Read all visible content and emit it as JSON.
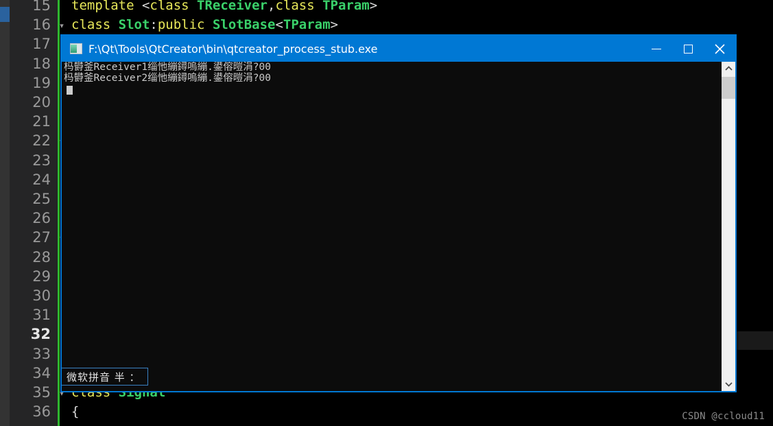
{
  "editor": {
    "lines": [
      {
        "num": "15",
        "fold": "",
        "current": false,
        "tokens": [
          {
            "t": "template ",
            "c": "kw"
          },
          {
            "t": "<",
            "c": "punc"
          },
          {
            "t": "class ",
            "c": "kw"
          },
          {
            "t": "TReceiver",
            "c": "type"
          },
          {
            "t": ",",
            "c": "punc"
          },
          {
            "t": "class ",
            "c": "kw"
          },
          {
            "t": "TParam",
            "c": "type"
          },
          {
            "t": ">",
            "c": "punc"
          }
        ]
      },
      {
        "num": "16",
        "fold": "▾",
        "current": false,
        "tokens": [
          {
            "t": "class ",
            "c": "kw"
          },
          {
            "t": "Slot",
            "c": "type"
          },
          {
            "t": ":",
            "c": "punc"
          },
          {
            "t": "public ",
            "c": "kw"
          },
          {
            "t": "SlotBase",
            "c": "type"
          },
          {
            "t": "<",
            "c": "punc"
          },
          {
            "t": "TParam",
            "c": "type"
          },
          {
            "t": ">",
            "c": "punc"
          }
        ]
      },
      {
        "num": "17",
        "fold": "",
        "current": false,
        "tokens": []
      },
      {
        "num": "18",
        "fold": "",
        "current": false,
        "tokens": []
      },
      {
        "num": "19",
        "fold": "",
        "current": false,
        "tokens": []
      },
      {
        "num": "20",
        "fold": "",
        "current": false,
        "tokens": []
      },
      {
        "num": "21",
        "fold": "",
        "current": false,
        "tokens": []
      },
      {
        "num": "22",
        "fold": "▾",
        "current": false,
        "tokens": []
      },
      {
        "num": "23",
        "fold": "",
        "current": false,
        "tokens": []
      },
      {
        "num": "24",
        "fold": "",
        "current": false,
        "tokens": []
      },
      {
        "num": "25",
        "fold": "",
        "current": false,
        "tokens": []
      },
      {
        "num": "26",
        "fold": "",
        "current": false,
        "tokens": []
      },
      {
        "num": "27",
        "fold": "▾",
        "current": false,
        "tokens": []
      },
      {
        "num": "28",
        "fold": "",
        "current": false,
        "tokens": []
      },
      {
        "num": "29",
        "fold": "",
        "current": false,
        "tokens": []
      },
      {
        "num": "30",
        "fold": "",
        "current": false,
        "tokens": []
      },
      {
        "num": "31",
        "fold": "",
        "current": false,
        "tokens": []
      },
      {
        "num": "32",
        "fold": "",
        "current": true,
        "tokens": []
      },
      {
        "num": "33",
        "fold": "",
        "current": false,
        "tokens": []
      },
      {
        "num": "34",
        "fold": "",
        "current": false,
        "tokens": []
      },
      {
        "num": "35",
        "fold": "▾",
        "current": false,
        "tokens": [
          {
            "t": "class ",
            "c": "kw"
          },
          {
            "t": "Signal",
            "c": "type"
          }
        ]
      },
      {
        "num": "36",
        "fold": "",
        "current": false,
        "tokens": [
          {
            "t": "{",
            "c": "punc"
          }
        ]
      }
    ],
    "change_bar_color": "#2fb72f",
    "marker_color": "#2a629e",
    "watermark": "CSDN @ccloud11"
  },
  "console": {
    "title": "F:\\Qt\\Tools\\QtCreator\\bin\\qtcreator_process_stub.exe",
    "title_icon": "console-window-icon",
    "titlebar_color": "#0078d4",
    "background_color": "#0c0c0c",
    "window_buttons": [
      {
        "name": "minimize-button",
        "glyph": "minimize-icon",
        "label": "Minimize"
      },
      {
        "name": "maximize-button",
        "glyph": "maximize-icon",
        "label": "Maximize"
      },
      {
        "name": "close-button",
        "glyph": "close-icon",
        "label": "Close"
      }
    ],
    "output_lines": [
      "杩欎釜Receiver1缁忚繃鐞嗚繃.鍙傛暟涓?00",
      "杩欎釜Receiver2缁忚繃鐞嗚繃.鍙傛暟涓?00"
    ],
    "ime_indicator": "微软拼音 半 ：",
    "scrollbar": {
      "up_arrow": "chevron-up-icon",
      "down_arrow": "chevron-down-icon",
      "thumb_position_percent": 4
    }
  }
}
